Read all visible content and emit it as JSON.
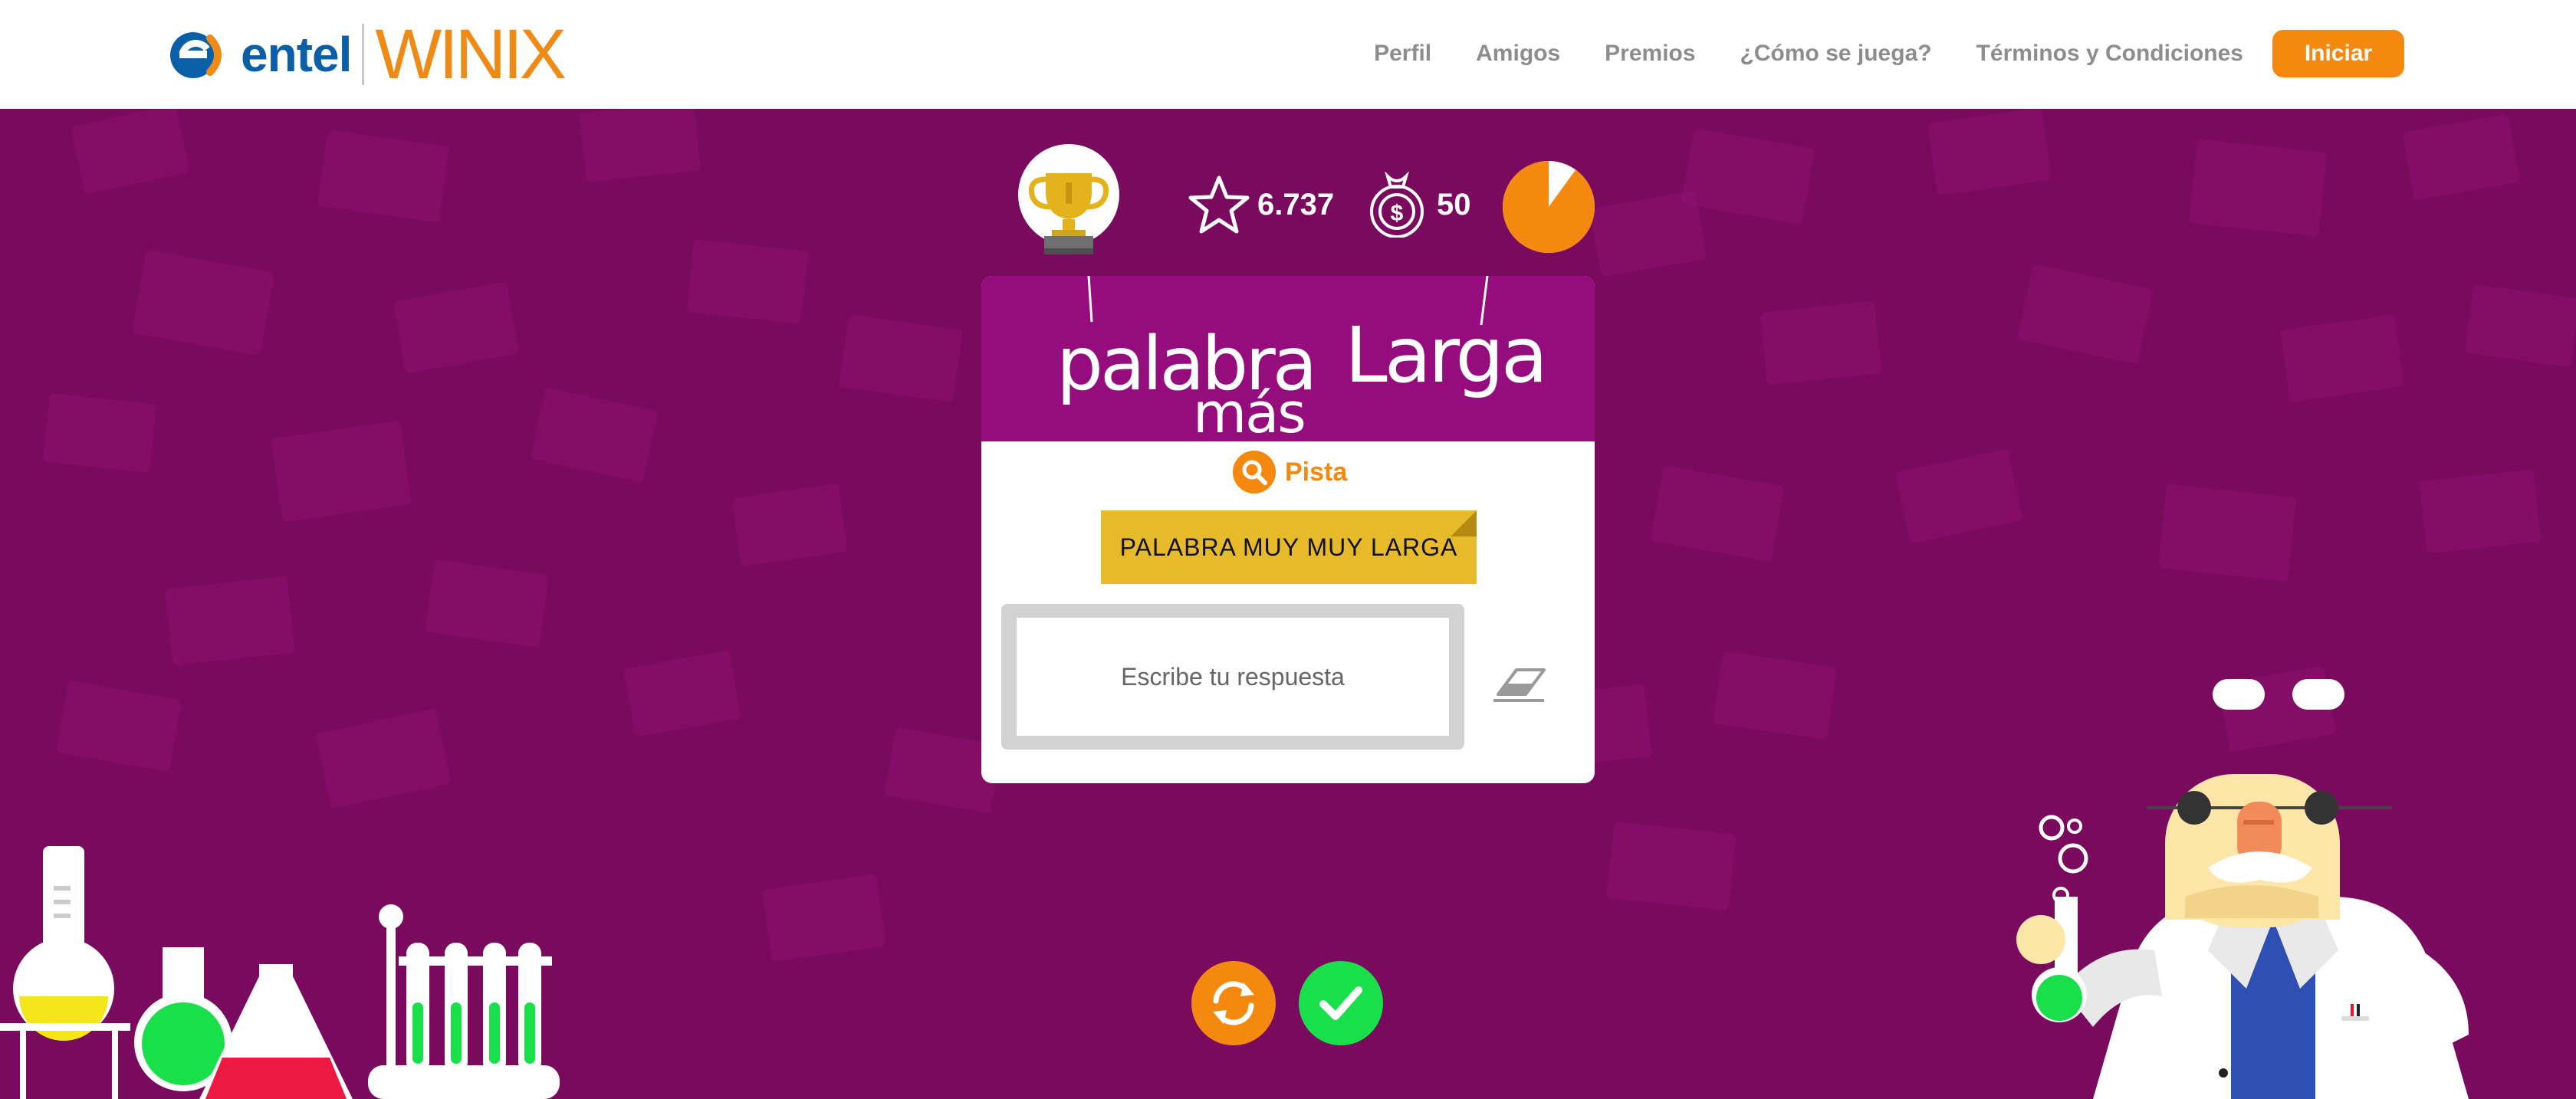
{
  "header": {
    "brand_left": "entel",
    "brand_right": "WINIX",
    "nav": [
      "Perfil",
      "Amigos",
      "Premios",
      "¿Cómo se juega?",
      "Términos y Condiciones"
    ],
    "start_button": "Iniciar"
  },
  "stats": {
    "stars": "6.737",
    "coins": "50",
    "timer_remaining_fraction": 0.9
  },
  "game": {
    "title_word_1": "palabra",
    "title_word_2": "más",
    "title_word_3": "Larga",
    "hint_label": "Pista",
    "word": "PALABRA MUY MUY LARGA",
    "answer_placeholder": "Escribe tu respuesta",
    "answer_value": ""
  },
  "colors": {
    "background": "#7a0a5e",
    "card_header": "#950c7c",
    "accent_orange": "#f5890f",
    "note_yellow": "#e7ba2c",
    "confirm_green": "#19e04a",
    "entel_blue": "#0a5fa8"
  },
  "icons": {
    "trophy": "trophy-icon",
    "star": "star-icon",
    "coin_bag": "coin-bag-icon",
    "timer": "timer-pie-icon",
    "search": "search-icon",
    "eraser": "eraser-icon",
    "refresh": "refresh-icon",
    "check": "check-icon"
  }
}
